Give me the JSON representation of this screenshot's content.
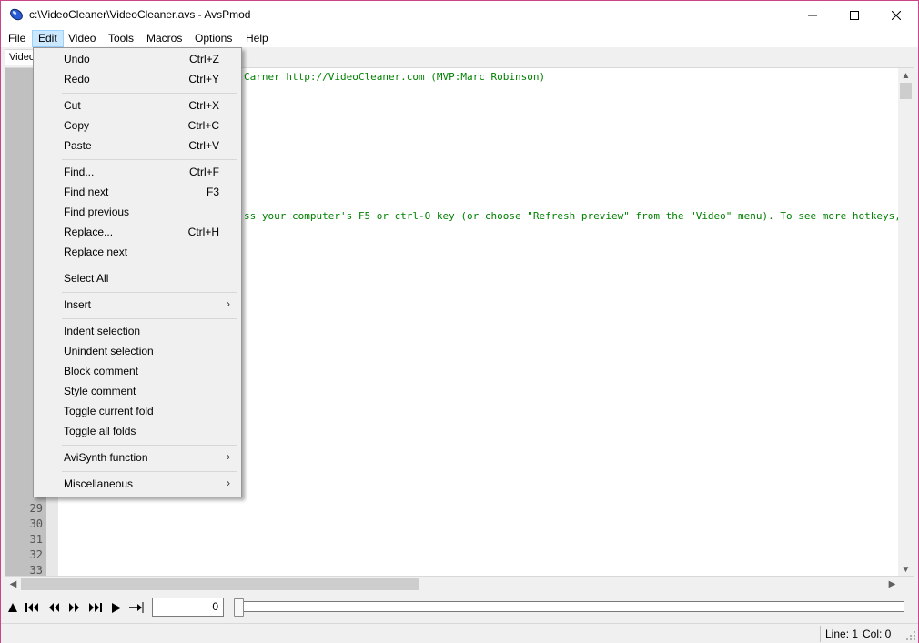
{
  "window": {
    "title": "c:\\VideoCleaner\\VideoCleaner.avs - AvsPmod"
  },
  "menubar": {
    "items": [
      "File",
      "Edit",
      "Video",
      "Tools",
      "Macros",
      "Options",
      "Help"
    ],
    "active": "Edit"
  },
  "tabs": [
    "Video"
  ],
  "edit_menu": {
    "items": [
      {
        "label": "Undo",
        "shortcut": "Ctrl+Z"
      },
      {
        "label": "Redo",
        "shortcut": "Ctrl+Y"
      },
      {
        "label": "Cut",
        "shortcut": "Ctrl+X"
      },
      {
        "label": "Copy",
        "shortcut": "Ctrl+C"
      },
      {
        "label": "Paste",
        "shortcut": "Ctrl+V"
      },
      {
        "label": "Find...",
        "shortcut": "Ctrl+F"
      },
      {
        "label": "Find next",
        "shortcut": "F3"
      },
      {
        "label": "Find previous",
        "shortcut": ""
      },
      {
        "label": "Replace...",
        "shortcut": "Ctrl+H"
      },
      {
        "label": "Replace next",
        "shortcut": ""
      },
      {
        "label": "Select All",
        "shortcut": ""
      },
      {
        "label": "Insert",
        "shortcut": "",
        "submenu": true
      },
      {
        "label": "Indent selection",
        "shortcut": ""
      },
      {
        "label": "Unindent selection",
        "shortcut": ""
      },
      {
        "label": "Block comment",
        "shortcut": ""
      },
      {
        "label": "Style comment",
        "shortcut": ""
      },
      {
        "label": "Toggle current fold",
        "shortcut": ""
      },
      {
        "label": "Toggle all folds",
        "shortcut": ""
      },
      {
        "label": "AviSynth function",
        "shortcut": "",
        "submenu": true
      },
      {
        "label": "Miscellaneous",
        "shortcut": "",
        "submenu": true
      }
    ]
  },
  "editor": {
    "visible_code": [
      "Carner    http://VideoCleaner.com    (MVP:Marc Robinson)",
      "ss your computer's   F5   or   ctrl-O   key (or choose \"Refresh preview\" from the \"Video\" menu). To see more hotkeys, press the   F"
    ],
    "line_numbers": [
      "29",
      "30",
      "31",
      "32",
      "33"
    ]
  },
  "playback": {
    "frame_value": "0"
  },
  "status": {
    "line": "Line: 1",
    "col": "Col: 0"
  },
  "colors": {
    "code_comment": "#008000",
    "menu_highlight": "#cce8ff",
    "window_border": "#c8458a"
  }
}
